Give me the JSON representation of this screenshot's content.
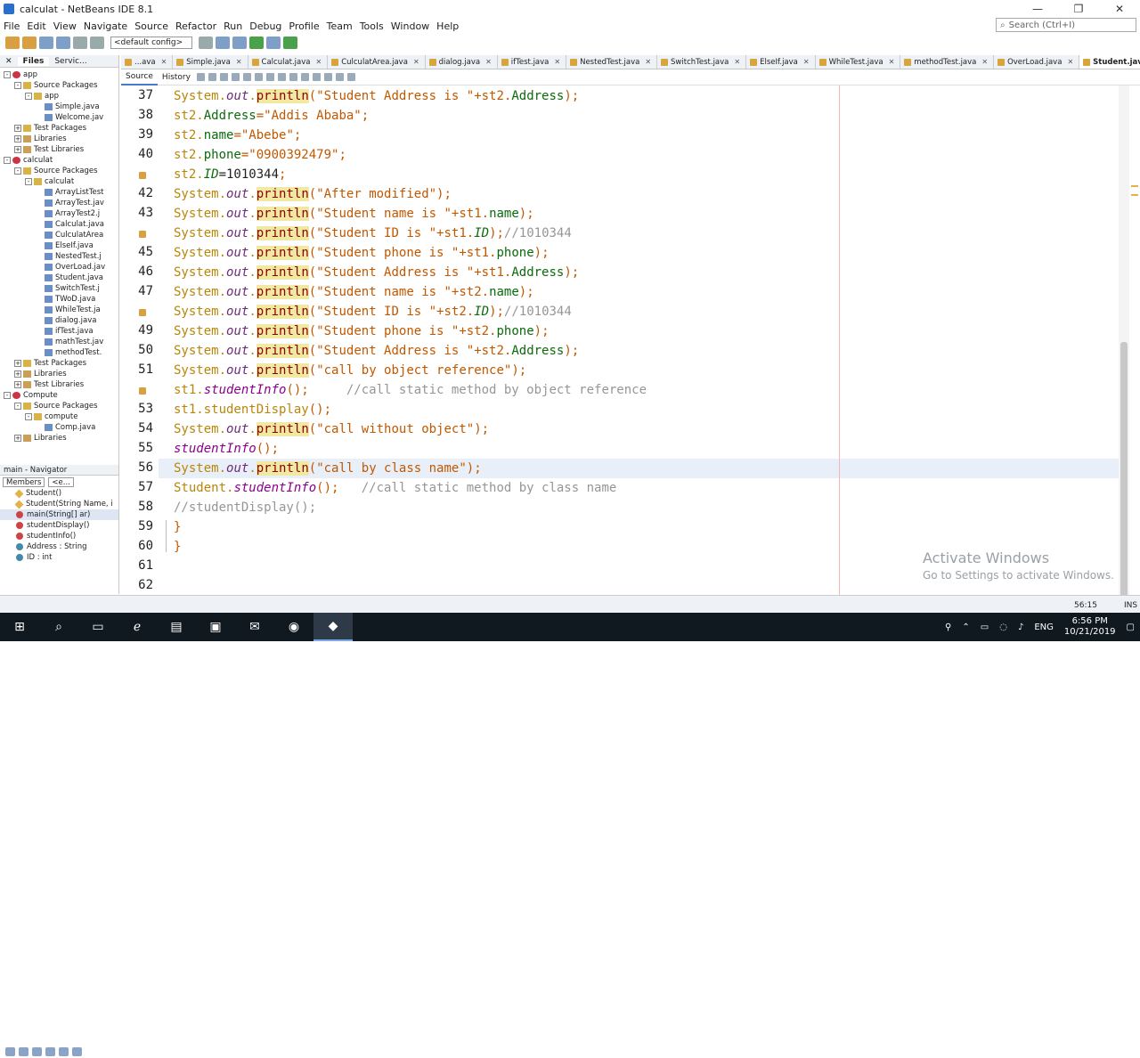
{
  "window": {
    "title": "calculat - NetBeans IDE 8.1",
    "min": "—",
    "max": "❐",
    "close": "✕"
  },
  "menu": [
    "File",
    "Edit",
    "View",
    "Navigate",
    "Source",
    "Refactor",
    "Run",
    "Debug",
    "Profile",
    "Team",
    "Tools",
    "Window",
    "Help"
  ],
  "search": {
    "placeholder": "Search (Ctrl+I)"
  },
  "toolbar": {
    "config": "<default config>"
  },
  "projects_panel": {
    "tabs": [
      "Files",
      "Servic..."
    ],
    "items": [
      {
        "label": "app",
        "kind": "proj",
        "indent": 0,
        "exp": "-"
      },
      {
        "label": "Source Packages",
        "kind": "pkg",
        "indent": 1,
        "exp": "-"
      },
      {
        "label": "app",
        "kind": "pkg",
        "indent": 2,
        "exp": "-"
      },
      {
        "label": "Simple.java",
        "kind": "fil",
        "indent": 3,
        "exp": ""
      },
      {
        "label": "Welcome.jav",
        "kind": "fil",
        "indent": 3,
        "exp": ""
      },
      {
        "label": "Test Packages",
        "kind": "pkg",
        "indent": 1,
        "exp": "+"
      },
      {
        "label": "Libraries",
        "kind": "lib",
        "indent": 1,
        "exp": "+"
      },
      {
        "label": "Test Libraries",
        "kind": "lib",
        "indent": 1,
        "exp": "+"
      },
      {
        "label": "calculat",
        "kind": "proj",
        "indent": 0,
        "exp": "-"
      },
      {
        "label": "Source Packages",
        "kind": "pkg",
        "indent": 1,
        "exp": "-"
      },
      {
        "label": "calculat",
        "kind": "pkg",
        "indent": 2,
        "exp": "-"
      },
      {
        "label": "ArrayListTest",
        "kind": "fil",
        "indent": 3,
        "exp": ""
      },
      {
        "label": "ArrayTest.jav",
        "kind": "fil",
        "indent": 3,
        "exp": ""
      },
      {
        "label": "ArrayTest2.j",
        "kind": "fil",
        "indent": 3,
        "exp": ""
      },
      {
        "label": "Calculat.java",
        "kind": "fil",
        "indent": 3,
        "exp": ""
      },
      {
        "label": "CulculatArea",
        "kind": "fil",
        "indent": 3,
        "exp": ""
      },
      {
        "label": "ElseIf.java",
        "kind": "fil",
        "indent": 3,
        "exp": ""
      },
      {
        "label": "NestedTest.j",
        "kind": "fil",
        "indent": 3,
        "exp": ""
      },
      {
        "label": "OverLoad.jav",
        "kind": "fil",
        "indent": 3,
        "exp": ""
      },
      {
        "label": "Student.java",
        "kind": "fil",
        "indent": 3,
        "exp": ""
      },
      {
        "label": "SwitchTest.j",
        "kind": "fil",
        "indent": 3,
        "exp": ""
      },
      {
        "label": "TWoD.java",
        "kind": "fil",
        "indent": 3,
        "exp": ""
      },
      {
        "label": "WhileTest.ja",
        "kind": "fil",
        "indent": 3,
        "exp": ""
      },
      {
        "label": "dialog.java",
        "kind": "fil",
        "indent": 3,
        "exp": ""
      },
      {
        "label": "ifTest.java",
        "kind": "fil",
        "indent": 3,
        "exp": ""
      },
      {
        "label": "mathTest.jav",
        "kind": "fil",
        "indent": 3,
        "exp": ""
      },
      {
        "label": "methodTest.",
        "kind": "fil",
        "indent": 3,
        "exp": ""
      },
      {
        "label": "Test Packages",
        "kind": "pkg",
        "indent": 1,
        "exp": "+"
      },
      {
        "label": "Libraries",
        "kind": "lib",
        "indent": 1,
        "exp": "+"
      },
      {
        "label": "Test Libraries",
        "kind": "lib",
        "indent": 1,
        "exp": "+"
      },
      {
        "label": "Compute",
        "kind": "proj",
        "indent": 0,
        "exp": "-"
      },
      {
        "label": "Source Packages",
        "kind": "pkg",
        "indent": 1,
        "exp": "-"
      },
      {
        "label": "compute",
        "kind": "pkg",
        "indent": 2,
        "exp": "-"
      },
      {
        "label": "Comp.java",
        "kind": "fil",
        "indent": 3,
        "exp": ""
      },
      {
        "label": "Libraries",
        "kind": "lib",
        "indent": 1,
        "exp": "+"
      }
    ]
  },
  "navigator": {
    "title": "main - Navigator",
    "filter": "Members",
    "filter2": "<e...",
    "items": [
      {
        "label": "Student()",
        "kind": "ctor"
      },
      {
        "label": "Student(String Name, i",
        "kind": "ctor"
      },
      {
        "label": "main(String[] ar)",
        "kind": "meth",
        "sel": true
      },
      {
        "label": "studentDisplay()",
        "kind": "meth"
      },
      {
        "label": "studentInfo()",
        "kind": "meth"
      },
      {
        "label": "Address : String",
        "kind": "fld"
      },
      {
        "label": "ID : int",
        "kind": "fld"
      }
    ]
  },
  "editor_tabs": [
    {
      "label": "...ava"
    },
    {
      "label": "Simple.java"
    },
    {
      "label": "Calculat.java"
    },
    {
      "label": "CulculatArea.java"
    },
    {
      "label": "dialog.java"
    },
    {
      "label": "ifTest.java"
    },
    {
      "label": "NestedTest.java"
    },
    {
      "label": "SwitchTest.java"
    },
    {
      "label": "ElseIf.java"
    },
    {
      "label": "WhileTest.java"
    },
    {
      "label": "methodTest.java"
    },
    {
      "label": "OverLoad.java"
    },
    {
      "label": "Student.java",
      "active": true
    }
  ],
  "editor_toolbar": {
    "source": "Source",
    "history": "History"
  },
  "code_lines": [
    {
      "n": "37",
      "ann": false,
      "segs": [
        [
          "sysc",
          "System."
        ],
        [
          "out",
          "out"
        ],
        [
          "sysc",
          "."
        ],
        [
          "println",
          "println"
        ],
        [
          "str",
          "(\"Student Address is \"+st2."
        ],
        [
          "fld2",
          "Address"
        ],
        [
          "str",
          ");"
        ]
      ]
    },
    {
      "n": "38",
      "ann": false,
      "segs": [
        [
          "sysc",
          "st2."
        ],
        [
          "fld2",
          "Address"
        ],
        [
          "str",
          "=\"Addis Ababa\";"
        ]
      ]
    },
    {
      "n": "39",
      "ann": false,
      "segs": [
        [
          "sysc",
          "st2."
        ],
        [
          "fld2",
          "name"
        ],
        [
          "str",
          "=\"Abebe\";"
        ]
      ]
    },
    {
      "n": "40",
      "ann": false,
      "segs": [
        [
          "sysc",
          "st2."
        ],
        [
          "fld2",
          "phone"
        ],
        [
          "str",
          "=\"0900392479\";"
        ]
      ]
    },
    {
      "n": "",
      "ann": true,
      "segs": [
        [
          "sysc",
          "st2."
        ],
        [
          "idv",
          "ID"
        ],
        [
          "num",
          "=1010344"
        ],
        [
          "str",
          ";"
        ]
      ]
    },
    {
      "n": "42",
      "ann": false,
      "segs": [
        [
          "sysc",
          "System."
        ],
        [
          "out",
          "out"
        ],
        [
          "sysc",
          "."
        ],
        [
          "println",
          "println"
        ],
        [
          "str",
          "(\"After modified\");"
        ]
      ]
    },
    {
      "n": "43",
      "ann": false,
      "segs": [
        [
          "sysc",
          "System."
        ],
        [
          "out",
          "out"
        ],
        [
          "sysc",
          "."
        ],
        [
          "println",
          "println"
        ],
        [
          "str",
          "(\"Student name is \"+st1."
        ],
        [
          "fld2",
          "name"
        ],
        [
          "str",
          ");"
        ]
      ]
    },
    {
      "n": "",
      "ann": true,
      "segs": [
        [
          "sysc",
          "System."
        ],
        [
          "out",
          "out"
        ],
        [
          "sysc",
          "."
        ],
        [
          "println",
          "println"
        ],
        [
          "str",
          "(\"Student ID is \"+st1."
        ],
        [
          "idv",
          "ID"
        ],
        [
          "str",
          ");"
        ],
        [
          "cmt",
          "//1010344"
        ]
      ]
    },
    {
      "n": "45",
      "ann": false,
      "segs": [
        [
          "sysc",
          "System."
        ],
        [
          "out",
          "out"
        ],
        [
          "sysc",
          "."
        ],
        [
          "println",
          "println"
        ],
        [
          "str",
          "(\"Student phone is \"+st1."
        ],
        [
          "fld2",
          "phone"
        ],
        [
          "str",
          ");"
        ]
      ]
    },
    {
      "n": "46",
      "ann": false,
      "segs": [
        [
          "sysc",
          "System."
        ],
        [
          "out",
          "out"
        ],
        [
          "sysc",
          "."
        ],
        [
          "println",
          "println"
        ],
        [
          "str",
          "(\"Student Address is \"+st1."
        ],
        [
          "fld2",
          "Address"
        ],
        [
          "str",
          ");"
        ]
      ]
    },
    {
      "n": "47",
      "ann": false,
      "segs": [
        [
          "sysc",
          "System."
        ],
        [
          "out",
          "out"
        ],
        [
          "sysc",
          "."
        ],
        [
          "println",
          "println"
        ],
        [
          "str",
          "(\"Student name is \"+st2."
        ],
        [
          "fld2",
          "name"
        ],
        [
          "str",
          ");"
        ]
      ]
    },
    {
      "n": "",
      "ann": true,
      "segs": [
        [
          "sysc",
          "System."
        ],
        [
          "out",
          "out"
        ],
        [
          "sysc",
          "."
        ],
        [
          "println",
          "println"
        ],
        [
          "str",
          "(\"Student ID is \"+st2."
        ],
        [
          "idv",
          "ID"
        ],
        [
          "str",
          ");"
        ],
        [
          "cmt",
          "//1010344"
        ]
      ]
    },
    {
      "n": "49",
      "ann": false,
      "segs": [
        [
          "sysc",
          "System."
        ],
        [
          "out",
          "out"
        ],
        [
          "sysc",
          "."
        ],
        [
          "println",
          "println"
        ],
        [
          "str",
          "(\"Student phone is \"+st2."
        ],
        [
          "fld2",
          "phone"
        ],
        [
          "str",
          ");"
        ]
      ]
    },
    {
      "n": "50",
      "ann": false,
      "segs": [
        [
          "sysc",
          "System."
        ],
        [
          "out",
          "out"
        ],
        [
          "sysc",
          "."
        ],
        [
          "println",
          "println"
        ],
        [
          "str",
          "(\"Student Address is \"+st2."
        ],
        [
          "fld2",
          "Address"
        ],
        [
          "str",
          ");"
        ]
      ]
    },
    {
      "n": "51",
      "ann": false,
      "segs": [
        [
          "sysc",
          "System."
        ],
        [
          "out",
          "out"
        ],
        [
          "sysc",
          "."
        ],
        [
          "println",
          "println"
        ],
        [
          "str",
          "(\"call by object reference\");"
        ]
      ]
    },
    {
      "n": "",
      "ann": true,
      "segs": [
        [
          "sysc",
          "st1."
        ],
        [
          "meth2",
          "studentInfo"
        ],
        [
          "str",
          "();     "
        ],
        [
          "cmt",
          "//call static method by object reference"
        ]
      ]
    },
    {
      "n": "53",
      "ann": false,
      "segs": [
        [
          "sysc",
          "st1.studentDisplay"
        ],
        [
          "str",
          "();"
        ]
      ]
    },
    {
      "n": "54",
      "ann": false,
      "segs": [
        [
          "sysc",
          "System."
        ],
        [
          "out",
          "out"
        ],
        [
          "sysc",
          "."
        ],
        [
          "println",
          "println"
        ],
        [
          "str",
          "(\"call without object\");"
        ]
      ]
    },
    {
      "n": "55",
      "ann": false,
      "segs": [
        [
          "meth2",
          "studentInfo"
        ],
        [
          "str",
          "();"
        ]
      ]
    },
    {
      "n": "56",
      "ann": false,
      "cur": true,
      "segs": [
        [
          "sysc",
          "System."
        ],
        [
          "out",
          "out"
        ],
        [
          "sysc",
          "."
        ],
        [
          "println",
          "println"
        ],
        [
          "str",
          "(\"call by class name\");"
        ]
      ]
    },
    {
      "n": "57",
      "ann": false,
      "segs": [
        [
          "sysc",
          "Student."
        ],
        [
          "meth2",
          "studentInfo"
        ],
        [
          "str",
          "();   "
        ],
        [
          "cmt",
          "//call static method by class name"
        ]
      ]
    },
    {
      "n": "58",
      "ann": false,
      "segs": [
        [
          "cmt",
          "//studentDisplay();"
        ]
      ]
    },
    {
      "n": "59",
      "ann": false,
      "segs": [
        [
          "str",
          "}"
        ]
      ]
    },
    {
      "n": "60",
      "ann": false,
      "segs": [
        [
          "str",
          "}"
        ]
      ]
    },
    {
      "n": "61",
      "ann": false,
      "segs": []
    },
    {
      "n": "62",
      "ann": false,
      "segs": []
    }
  ],
  "watermark": {
    "line1": "Activate Windows",
    "line2": "Go to Settings to activate Windows."
  },
  "status": {
    "position": "56:15",
    "mode": "INS"
  },
  "taskbar": {
    "lang": "ENG",
    "time": "6:56 PM",
    "date": "10/21/2019"
  }
}
